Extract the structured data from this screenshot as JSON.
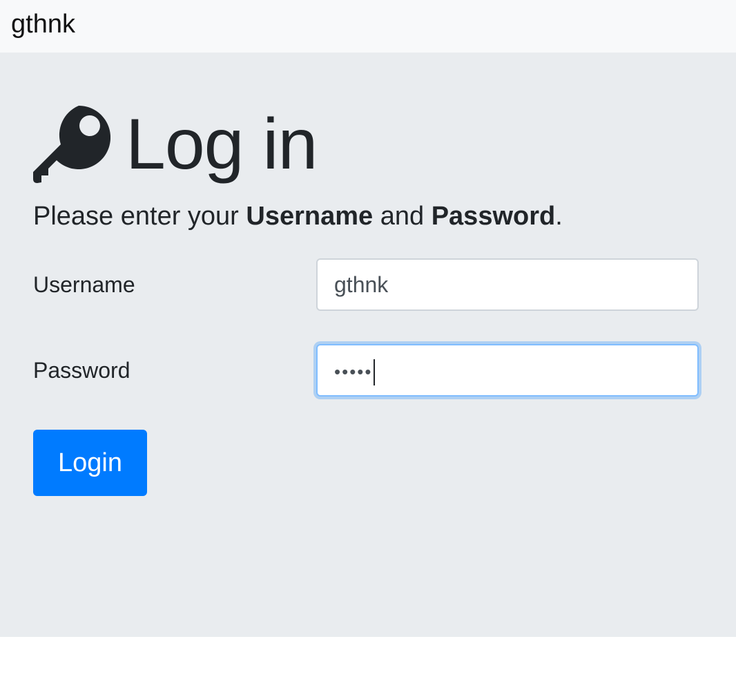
{
  "navbar": {
    "brand": "gthnk"
  },
  "login": {
    "title": "Log in",
    "title_icon": "key-icon",
    "lead_prefix": "Please enter your ",
    "lead_username": "Username",
    "lead_middle": " and ",
    "lead_password": "Password",
    "lead_suffix": ".",
    "username_label": "Username",
    "username_value": "gthnk",
    "password_label": "Password",
    "password_masked": "•••••",
    "button_label": "Login"
  },
  "colors": {
    "navbar_bg": "#f8f9fa",
    "jumbotron_bg": "#e9ecef",
    "primary": "#007bff",
    "focus_border": "#80bdff"
  }
}
